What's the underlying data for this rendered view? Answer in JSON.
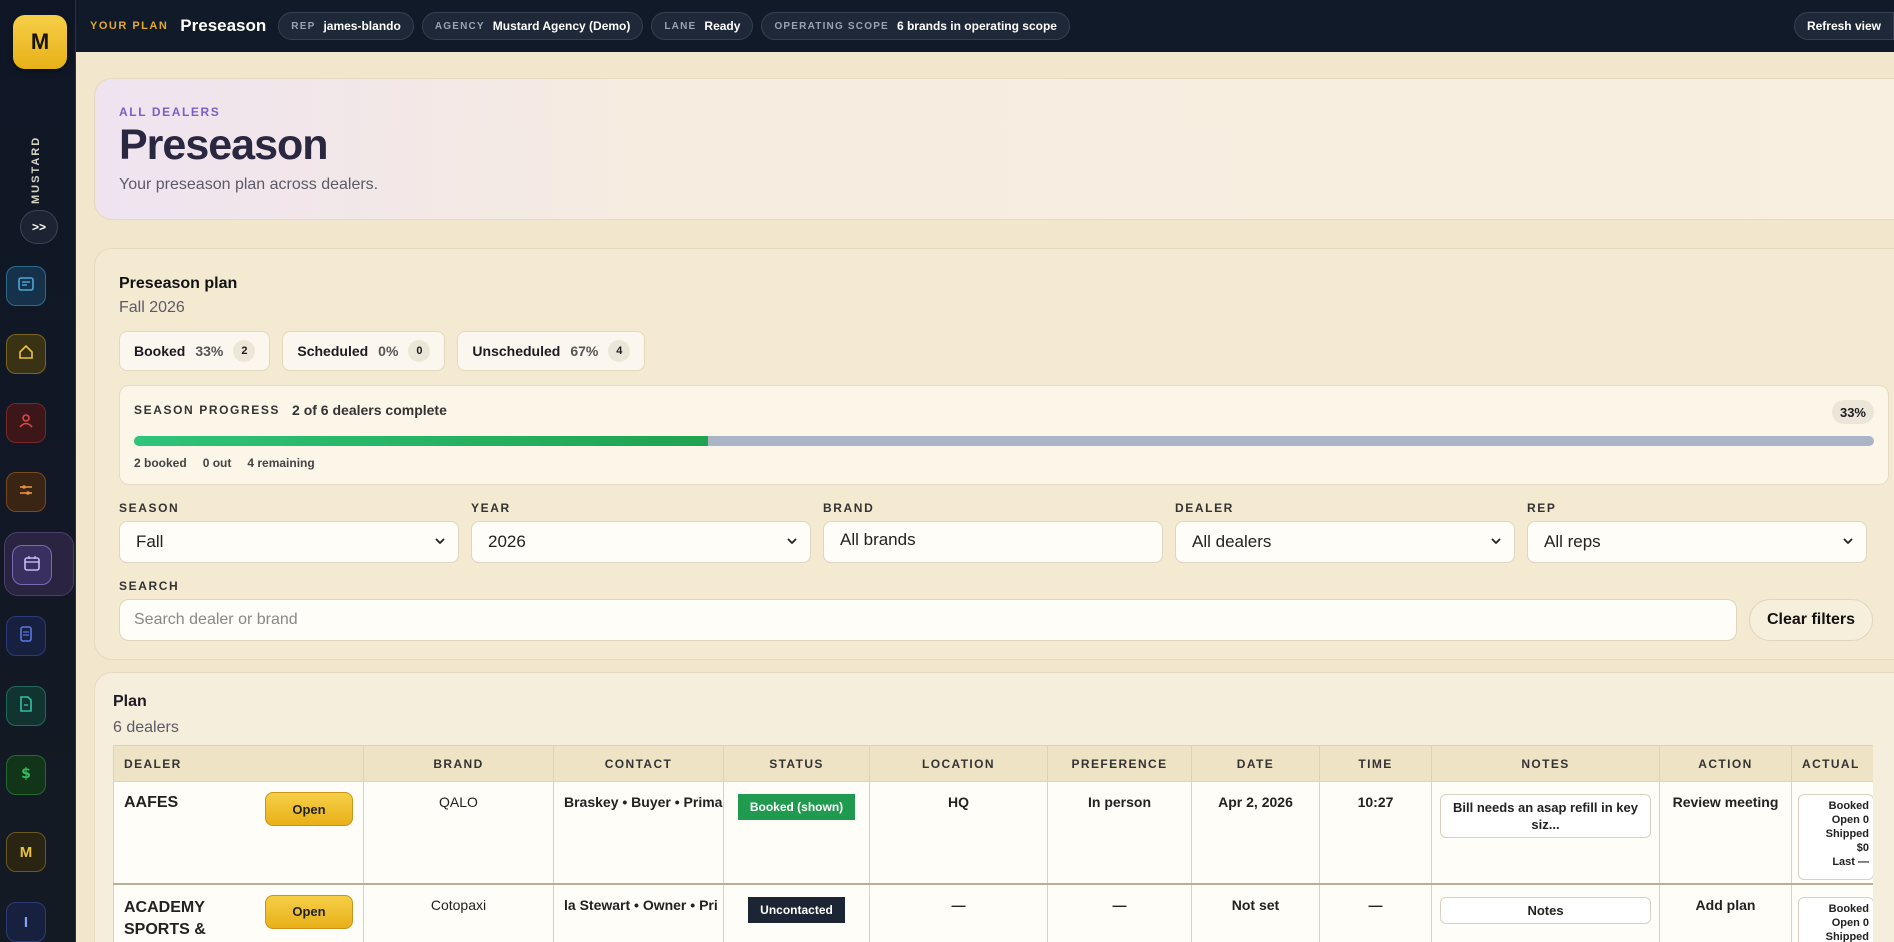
{
  "sidebar": {
    "logo_letter": "M",
    "brand_label": "MUSTARD",
    "expand_label": ">>",
    "items": [
      {
        "icon": "card-icon",
        "color": "#4aa8d8"
      },
      {
        "icon": "home-icon",
        "color": "#e8c440"
      },
      {
        "icon": "people-icon",
        "color": "#e0484a"
      },
      {
        "icon": "sliders-icon",
        "color": "#e89040"
      },
      {
        "icon": "calendar-icon",
        "color": "#a894e8"
      },
      {
        "icon": "document-icon",
        "color": "#5a78e0"
      },
      {
        "icon": "file-edit-icon",
        "color": "#30c0a0"
      },
      {
        "icon": "dollar-icon",
        "color": "#30c060"
      },
      {
        "icon": "m-badge-icon",
        "label": "M",
        "color": "#e8c440"
      },
      {
        "icon": "i-badge-icon",
        "label": "I",
        "color": "#5a78e0"
      }
    ]
  },
  "topbar": {
    "plan_label": "YOUR PLAN",
    "plan_title": "Preseason",
    "chips": [
      {
        "key": "REP",
        "value": "james-blando"
      },
      {
        "key": "AGENCY",
        "value": "Mustard Agency (Demo)"
      },
      {
        "key": "LANE",
        "value": "Ready"
      },
      {
        "key": "OPERATING SCOPE",
        "value": "6 brands in operating scope"
      }
    ],
    "refresh_label": "Refresh view"
  },
  "hero": {
    "eyebrow": "ALL DEALERS",
    "title": "Preseason",
    "subtitle": "Your preseason plan across dealers."
  },
  "plan_panel": {
    "title": "Preseason plan",
    "season": "Fall 2026",
    "stats": [
      {
        "label": "Booked",
        "pct": "33%",
        "count": "2"
      },
      {
        "label": "Scheduled",
        "pct": "0%",
        "count": "0"
      },
      {
        "label": "Unscheduled",
        "pct": "67%",
        "count": "4"
      }
    ],
    "progress": {
      "label": "SEASON PROGRESS",
      "summary": "2 of 6 dealers complete",
      "pct_label": "33%",
      "fraction": 0.33,
      "booked": "2 booked",
      "out": "0 out",
      "remaining": "4 remaining"
    },
    "filters": [
      {
        "label": "SEASON",
        "value": "Fall",
        "dropdown": true
      },
      {
        "label": "YEAR",
        "value": "2026",
        "dropdown": true
      },
      {
        "label": "BRAND",
        "value": "All brands",
        "dropdown": false
      },
      {
        "label": "DEALER",
        "value": "All dealers",
        "dropdown": true
      },
      {
        "label": "REP",
        "value": "All reps",
        "dropdown": true
      }
    ],
    "search_label": "SEARCH",
    "search_placeholder": "Search dealer or brand",
    "clear_label": "Clear filters"
  },
  "plan": {
    "title": "Plan",
    "count": "6 dealers",
    "columns": [
      "DEALER",
      "BRAND",
      "CONTACT",
      "STATUS",
      "LOCATION",
      "PREFERENCE",
      "DATE",
      "TIME",
      "NOTES",
      "ACTION",
      "ACTUAL"
    ],
    "open_label": "Open",
    "rows": [
      {
        "dealer": "AAFES",
        "brand": "QALO",
        "contact": "Braskey • Buyer • Prima",
        "status": "Booked (shown)",
        "location": "HQ",
        "preference": "In person",
        "date": "Apr 2, 2026",
        "time": "10:27",
        "notes": "Bill needs an asap refill in key siz...",
        "action": "Review meeting",
        "actual": [
          "Booked",
          "Open 0",
          "Shipped",
          "$0",
          "Last —"
        ]
      },
      {
        "dealer": "ACADEMY SPORTS &",
        "brand": "Cotopaxi",
        "contact": "la Stewart • Owner • Pri",
        "status": "Uncontacted",
        "location": "—",
        "preference": "—",
        "date": "Not set",
        "time": "—",
        "notes": "Notes",
        "action": "Add plan",
        "actual": [
          "Booked",
          "Open 0",
          "Shipped"
        ]
      }
    ]
  }
}
